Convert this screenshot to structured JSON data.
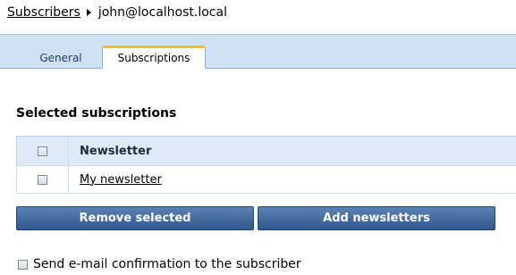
{
  "breadcrumb": {
    "parent_label": "Subscribers",
    "current_label": "john@localhost.local"
  },
  "tabs": [
    {
      "label": "General",
      "selected": false
    },
    {
      "label": "Subscriptions",
      "selected": true
    }
  ],
  "section": {
    "title": "Selected subscriptions"
  },
  "grid": {
    "header": {
      "column_label": "Newsletter",
      "checked": false
    },
    "rows": [
      {
        "name": "My newsletter",
        "checked": false
      }
    ]
  },
  "buttons": {
    "remove_label": "Remove selected",
    "add_label": "Add newsletters"
  },
  "confirmation": {
    "label": "Send e-mail confirmation to the subscriber",
    "checked": false
  },
  "colors": {
    "tab_accent": "#f3c22b",
    "button": "#3d6496",
    "grid_header": "#dfeaf6",
    "tabstrip": "#cfe2f5"
  }
}
